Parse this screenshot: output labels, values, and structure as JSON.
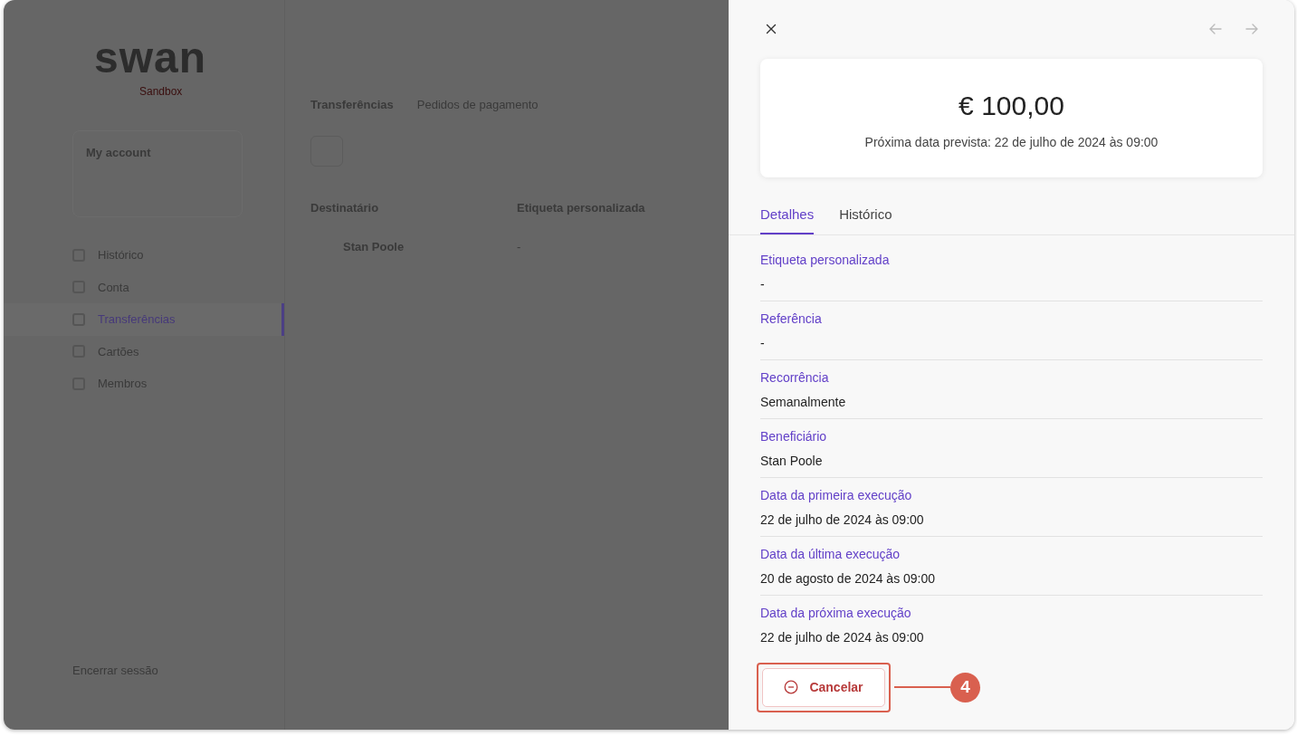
{
  "background": {
    "logo": "swan",
    "environment": "Sandbox",
    "account": {
      "name": "My account"
    },
    "nav": [
      {
        "label": "Histórico",
        "selected": false
      },
      {
        "label": "Conta",
        "selected": false
      },
      {
        "label": "Transferências",
        "selected": true
      },
      {
        "label": "Cartões",
        "selected": false
      },
      {
        "label": "Membros",
        "selected": false
      }
    ],
    "logout": "Encerrar sessão",
    "tabs": [
      {
        "label": "Transferências",
        "selected": true
      },
      {
        "label": "Pedidos de pagamento",
        "selected": false
      }
    ],
    "table": {
      "columns": [
        "Destinatário",
        "Etiqueta personalizada"
      ],
      "rows": [
        [
          "Stan Poole",
          "-"
        ]
      ]
    }
  },
  "panel": {
    "amount": "€ 100,00",
    "next_date": "Próxima data prevista: 22 de julho de 2024 às 09:00",
    "tabs": [
      {
        "label": "Detalhes",
        "selected": true
      },
      {
        "label": "Histórico",
        "selected": false
      }
    ],
    "details": [
      {
        "label": "Etiqueta personalizada",
        "value": "-"
      },
      {
        "label": "Referência",
        "value": "-"
      },
      {
        "label": "Recorrência",
        "value": "Semanalmente"
      },
      {
        "label": "Beneficiário",
        "value": "Stan Poole"
      },
      {
        "label": "Data da primeira execução",
        "value": "22 de julho de 2024 às 09:00"
      },
      {
        "label": "Data da última execução",
        "value": "20 de agosto de 2024 às 09:00"
      },
      {
        "label": "Data da próxima execução",
        "value": "22 de julho de 2024 às 09:00"
      }
    ],
    "cancel_button": "Cancelar"
  },
  "callout": {
    "number": "4"
  }
}
